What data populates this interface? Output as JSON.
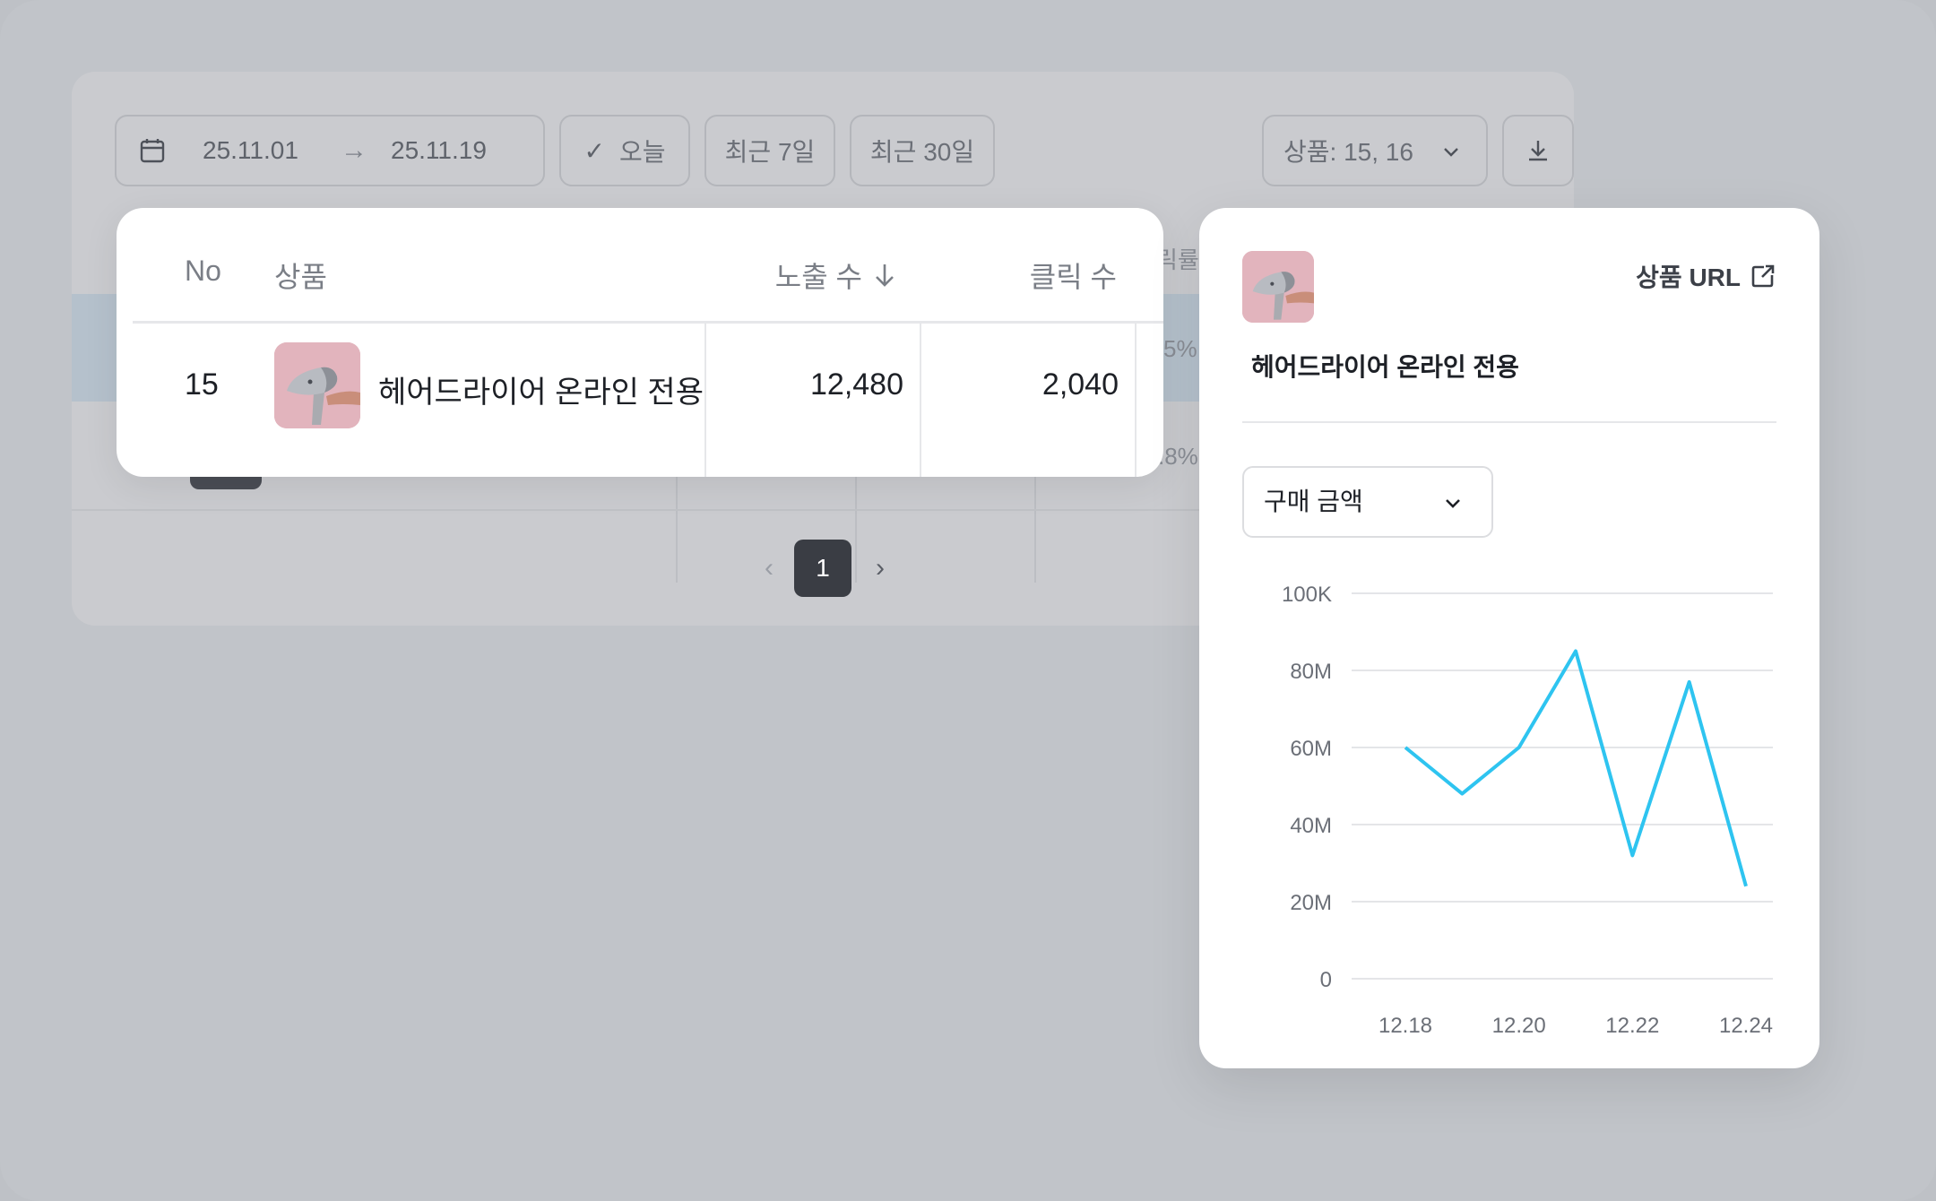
{
  "toolbar": {
    "date_start": "25.11.01",
    "date_end": "25.11.19",
    "today_label": "오늘",
    "last7_label": "최근 7일",
    "last30_label": "최근 30일",
    "product_filter": "상품: 15, 16"
  },
  "background_table": {
    "partial_header": "릭률",
    "partial_values": [
      "5%",
      ".8%"
    ]
  },
  "pagination": {
    "current_page": "1"
  },
  "table": {
    "headers": {
      "no": "No",
      "product": "상품",
      "impressions": "노출 수",
      "clicks": "클릭 수"
    },
    "rows": [
      {
        "no": "15",
        "product": "헤어드라이어 온라인 전용",
        "impressions": "12,480",
        "clicks": "2,040"
      }
    ]
  },
  "detail": {
    "url_label": "상품 URL",
    "product_name": "헤어드라이어 온라인 전용",
    "metric_selected": "구매 금액"
  },
  "chart_data": {
    "type": "line",
    "y_tick_labels": [
      "100K",
      "80M",
      "60M",
      "40M",
      "20M",
      "0"
    ],
    "x_tick_labels": [
      "12.18",
      "12.20",
      "12.22",
      "12.24"
    ],
    "x": [
      "12.18",
      "12.19",
      "12.20",
      "12.21",
      "12.22",
      "12.23",
      "12.24"
    ],
    "series": [
      {
        "values": [
          60,
          48,
          60,
          85,
          32,
          77,
          24
        ]
      }
    ],
    "ylim": [
      0,
      100
    ],
    "grid": true,
    "line_color": "#2ec4f0"
  }
}
